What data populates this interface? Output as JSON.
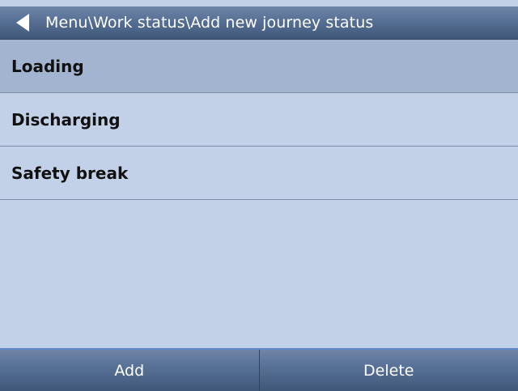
{
  "header": {
    "title": "Menu\\Work status\\Add new journey status",
    "back_icon": "back-arrow-icon"
  },
  "statuses": [
    {
      "label": "Loading"
    },
    {
      "label": "Discharging"
    },
    {
      "label": "Safety break"
    }
  ],
  "footer": {
    "add_label": "Add",
    "delete_label": "Delete"
  }
}
